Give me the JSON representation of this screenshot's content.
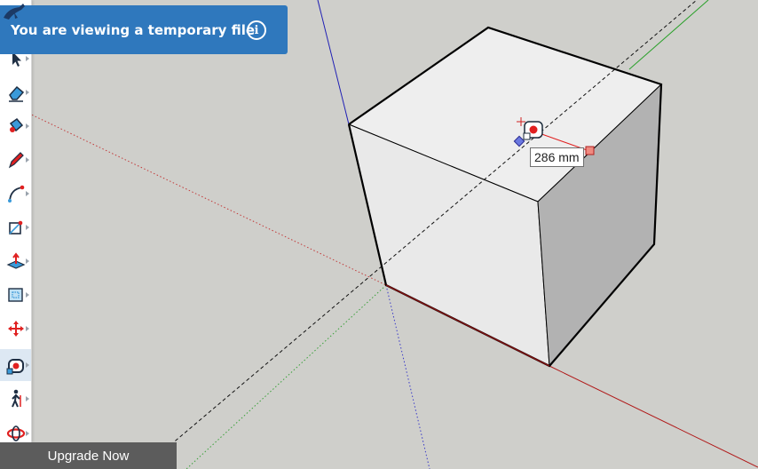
{
  "banner": {
    "text": "You are viewing a temporary file",
    "info_icon": "info-icon"
  },
  "measurement": {
    "value": "286 mm"
  },
  "upgrade": {
    "label": "Upgrade Now"
  },
  "toolbar": {
    "tools": [
      {
        "name": "select-icon"
      },
      {
        "name": "eraser-icon"
      },
      {
        "name": "paint-bucket-icon"
      },
      {
        "name": "pencil-icon"
      },
      {
        "name": "arc-icon"
      },
      {
        "name": "rectangle-icon"
      },
      {
        "name": "push-pull-icon"
      },
      {
        "name": "offset-icon"
      },
      {
        "name": "move-icon"
      },
      {
        "name": "tape-measure-icon",
        "active": true
      },
      {
        "name": "walk-icon"
      },
      {
        "name": "orbit-icon"
      }
    ]
  },
  "colors": {
    "canvas": "#cfcfcb",
    "banner": "#2f78bd",
    "axis_red": "#b01818",
    "axis_green": "#2aa02a",
    "axis_blue": "#1c1cb4",
    "upgrade_bg": "#5c5c5c"
  }
}
